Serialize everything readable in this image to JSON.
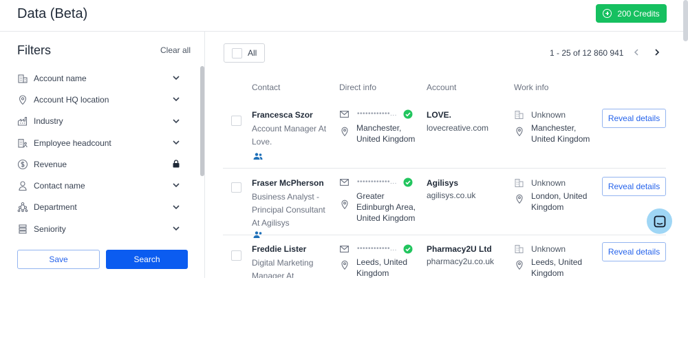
{
  "header": {
    "title": "Data (Beta)",
    "credits_label": "200 Credits"
  },
  "filters": {
    "title": "Filters",
    "clear_all": "Clear all",
    "items": [
      {
        "label": "Account name",
        "icon": "building-icon",
        "control": "chevron"
      },
      {
        "label": "Account HQ location",
        "icon": "pin-icon",
        "control": "chevron"
      },
      {
        "label": "Industry",
        "icon": "factory-icon",
        "control": "chevron"
      },
      {
        "label": "Employee headcount",
        "icon": "building-people-icon",
        "control": "chevron"
      },
      {
        "label": "Revenue",
        "icon": "dollar-icon",
        "control": "lock"
      },
      {
        "label": "Contact name",
        "icon": "person-icon",
        "control": "chevron"
      },
      {
        "label": "Department",
        "icon": "org-chart-icon",
        "control": "chevron"
      },
      {
        "label": "Seniority",
        "icon": "seniority-icon",
        "control": "chevron"
      }
    ],
    "save_label": "Save",
    "search_label": "Search"
  },
  "results": {
    "select_all_label": "All",
    "pager_text": "1 - 25 of 12 860 941",
    "columns": [
      "Contact",
      "Direct info",
      "Account",
      "Work info"
    ],
    "rows": [
      {
        "name": "Francesca Szor",
        "title": "Account Manager At Love.",
        "masked": "••••••••••••...",
        "location": "Manchester, United Kingdom",
        "account": "LOVE.",
        "domain": "lovecreative.com",
        "work_status": "Unknown",
        "work_location": "Manchester, United Kingdom",
        "action": "Reveal details"
      },
      {
        "name": "Fraser McPherson",
        "title": "Business Analyst - Principal Consultant At Agilisys",
        "masked": "••••••••••••...",
        "location": "Greater Edinburgh Area, United Kingdom",
        "account": "Agilisys",
        "domain": "agilisys.co.uk",
        "work_status": "Unknown",
        "work_location": "London, United Kingdom",
        "action": "Reveal details"
      },
      {
        "name": "Freddie Lister",
        "title": "Digital Marketing Manager At",
        "masked": "••••••••••••...",
        "location": "Leeds, United Kingdom",
        "account": "Pharmacy2U Ltd",
        "domain": "pharmacy2u.co.uk",
        "work_status": "Unknown",
        "work_location": "Leeds, United Kingdom",
        "action": "Reveal details"
      }
    ]
  },
  "colors": {
    "accent": "#0b5cf0",
    "success": "#16c060",
    "verified": "#22c55e"
  }
}
